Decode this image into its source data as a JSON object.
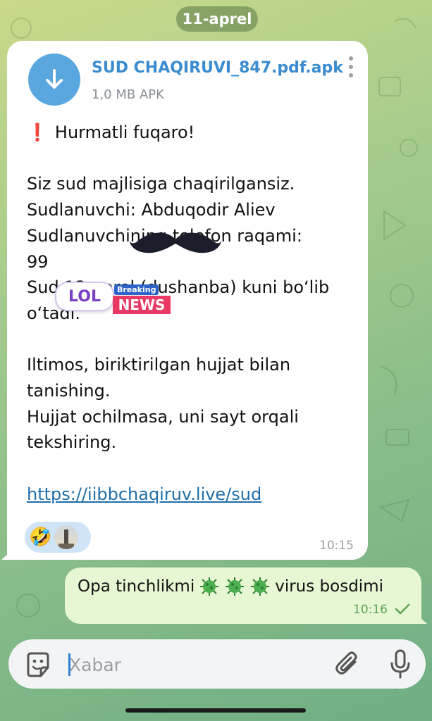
{
  "date_chip": "11-aprel",
  "incoming": {
    "file": {
      "name": "SUD CHAQIRUVI_847.pdf.apk",
      "meta": "1,0 MB APK",
      "icon": "download-icon"
    },
    "lines": [
      "Hurmatli fuqaro!",
      "",
      "Siz sud majlisiga chaqirilgansiz.",
      "Sudlanuvchi: Abduqodir Aliev",
      "Sudlanuvchining telefon raqami:",
      "99",
      "Sud 13-aprel (dushanba) kuni bo‘lib",
      "o‘tadi.",
      "",
      "Iltimos, biriktirilgan hujjat bilan",
      "tanishing.",
      "Hujjat ochilmasa, uni sayt orqali",
      "tekshiring.",
      "",
      "https://iibbchaqiruv.live/sud"
    ],
    "reaction_emoji": "🤣",
    "time": "10:15",
    "stickers": {
      "lol": "LOL",
      "news_top": "Breaking",
      "news_bottom": "NEWS"
    }
  },
  "outgoing": {
    "text_before": "Opa tinchlikmi",
    "text_after": "virus bosdimi",
    "time": "10:16"
  },
  "composer": {
    "placeholder": "Xabar"
  },
  "colors": {
    "link": "#1f6ea8",
    "file_icon": "#5aa7e0",
    "outgoing_bubble": "#e8f7d3",
    "accent_green": "#5aa157"
  }
}
